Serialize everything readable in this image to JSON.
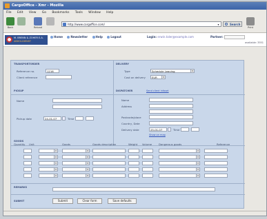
{
  "window": {
    "title": "CargoOffice - Xmr - Mozilla"
  },
  "menu": {
    "items": [
      "File",
      "Edit",
      "View",
      "Go",
      "Bookmarks",
      "Tools",
      "Window",
      "Help"
    ]
  },
  "toolbar": {
    "back_label": "Back",
    "forward_label": "",
    "reload_label": "Reload",
    "stop_label": "",
    "address": "http://www.cargoffice.com/",
    "search_label": "Search",
    "print_label": "Print"
  },
  "app": {
    "logo_line1": "M. BRENN & ZOHER E.A.",
    "logo_line2": "ABHOLDIENST",
    "nav": [
      "Home",
      "Newsletter",
      "Help",
      "Logout"
    ],
    "login_label": "Login:",
    "login_value": "erwin.taler@example.com",
    "partner_label": "Partner:",
    "user_label": "available: 3551"
  },
  "form": {
    "transport_header": "TRANSPORTORDER",
    "reference_label": "Reference no.",
    "reference_value": "1216",
    "client_reference_label": "Client reference",
    "delivery_header": "DELIVERY",
    "type_label": "Type",
    "type_value": "Schedule Leaving",
    "cost_label": "Cost on delivery",
    "cost_value": "EUR",
    "pickup_header": "PICKUP",
    "pickup_name_label": "Name",
    "pickup_date_label": "Pickup date",
    "pickup_date_value": "24-01-07",
    "pickup_time_label": "Time",
    "dispatcher_header": "DISPATCHER",
    "new_customer_link": "Send client infoset",
    "disp_name_label": "Name",
    "disp_address_label": "Address",
    "disp_postcode_label": "Postcode/place",
    "disp_country_label": "Country, Date",
    "disp_delivery_label": "Delivery date",
    "disp_delivery_value": "25-01-07",
    "disp_time_label": "Time",
    "show_map_link": "Show on map",
    "goods_header": "GOODS",
    "goods_columns": [
      "Quantity",
      "Unit",
      "Goods",
      "Goods description",
      "Weight",
      "Volume",
      "Dangerous goods",
      "Reference"
    ],
    "remarks_label": "REMARKS",
    "submit_row_label": "SUBMIT",
    "submit_button": "Submit",
    "clear_button": "Clear form",
    "save_defaults_button": "Save defaults"
  },
  "status": {
    "text": ""
  }
}
